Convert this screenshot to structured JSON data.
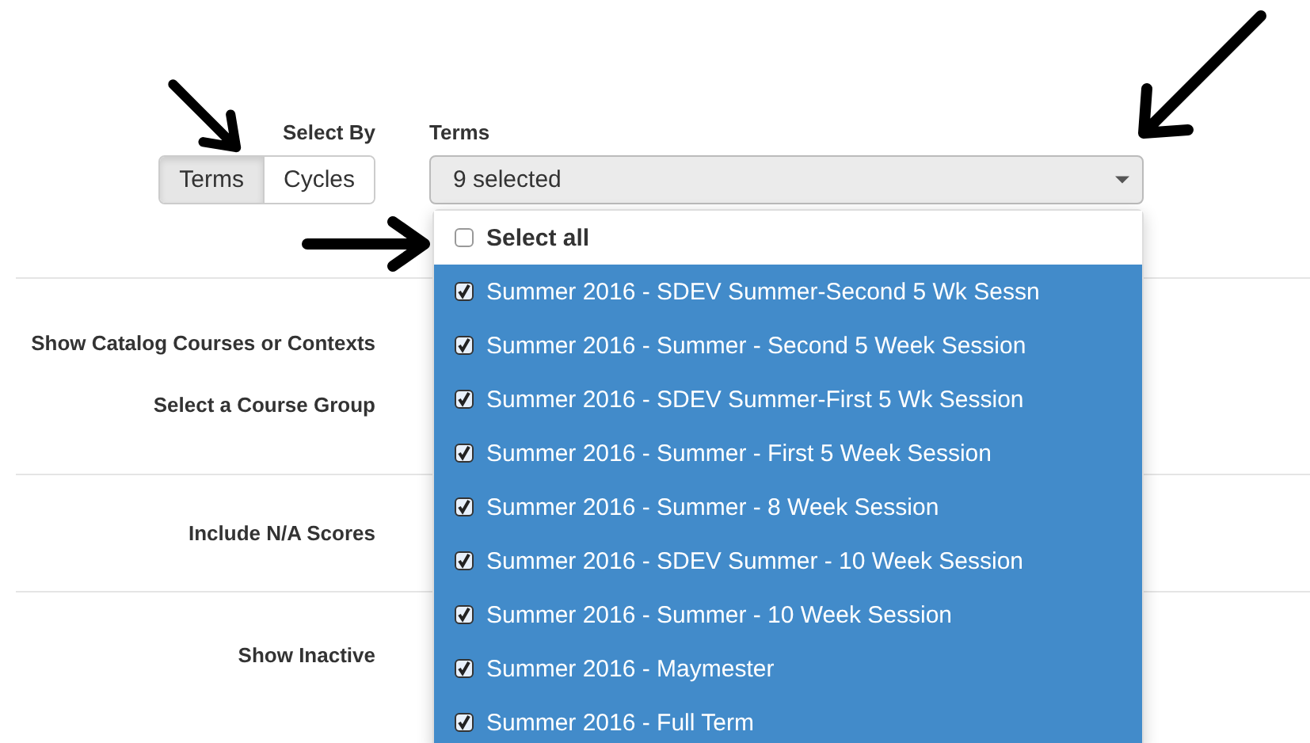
{
  "select_by": {
    "label": "Select By",
    "options": [
      {
        "label": "Terms",
        "selected": true
      },
      {
        "label": "Cycles",
        "selected": false
      }
    ]
  },
  "terms": {
    "label": "Terms",
    "value": "9 selected",
    "dropdown": {
      "select_all": {
        "label": "Select all",
        "checked": false
      },
      "items": [
        {
          "label": "Summer 2016 - SDEV Summer-Second 5 Wk Sessn",
          "checked": true
        },
        {
          "label": "Summer 2016 - Summer - Second 5 Week Session",
          "checked": true
        },
        {
          "label": "Summer 2016 - SDEV Summer-First 5 Wk Session",
          "checked": true
        },
        {
          "label": "Summer 2016 - Summer - First 5 Week Session",
          "checked": true
        },
        {
          "label": "Summer 2016 - Summer - 8 Week Session",
          "checked": true
        },
        {
          "label": "Summer 2016 - SDEV Summer - 10 Week Session",
          "checked": true
        },
        {
          "label": "Summer 2016 - Summer - 10 Week Session",
          "checked": true
        },
        {
          "label": "Summer 2016 - Maymester",
          "checked": true
        },
        {
          "label": "Summer 2016 - Full Term",
          "checked": true
        }
      ]
    }
  },
  "sections": [
    {
      "rows": [
        {
          "label": "Show Catalog Courses or Contexts"
        },
        {
          "label": "Select a Course Group"
        }
      ]
    },
    {
      "rows": [
        {
          "label": "Include N/A Scores"
        }
      ]
    },
    {
      "rows": [
        {
          "label": "Show Inactive"
        }
      ]
    }
  ]
}
